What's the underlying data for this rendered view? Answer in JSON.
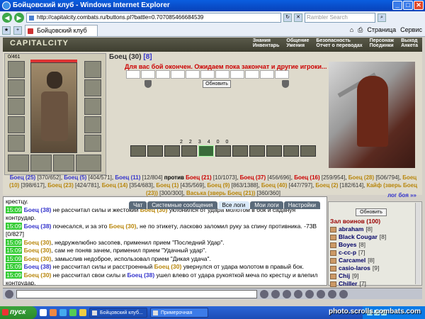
{
  "window": {
    "title": "Бойцовский клуб - Windows Internet Explorer"
  },
  "browser": {
    "url": "http://capitalcity.combats.ru/buttons.pl?battle=0.707085466684539",
    "search_placeholder": "Rambler Search",
    "tab_title": "Бойцовский клуб",
    "page_menu": "Страница",
    "service_menu": "Сервис"
  },
  "game": {
    "logo": "CAPITALCITY",
    "menu": [
      "Знания",
      "Общение",
      "Безопасность",
      "Персонаж",
      "Выход",
      "Инвентарь",
      "Умения",
      "Отчет о переводах",
      "Поединки",
      "Анкета"
    ],
    "player_tag": "0/461",
    "enemy_name": "Боец (30)",
    "enemy_level": "[8]",
    "battle_message": "Для вас бой окончен. Ожидаем пока закончат и другие игроки...",
    "refresh_button": "Обновить",
    "counters": [
      "2",
      "2",
      "3",
      "4",
      "0",
      "0"
    ],
    "vs": "против",
    "logs_link": "лог боя »»"
  },
  "teams": {
    "left": [
      {
        "name": "Боец (25)",
        "hp": "[370/652]"
      },
      {
        "name": "Боец (5)",
        "hp": "[404/571]"
      },
      {
        "name": "Боец (11)",
        "hp": "[12/804]"
      },
      {
        "name": "Боец (28)",
        "hp": "[506/794]"
      },
      {
        "name": "Боец (10)",
        "hp": "[398/617]"
      },
      {
        "name": "Боец (23)",
        "hp": "[424/781]"
      },
      {
        "name": "Боец (14)",
        "hp": "[354/683]"
      },
      {
        "name": "Боец (1)",
        "hp": "[435/569]"
      },
      {
        "name": "Боец (9)",
        "hp": "[863/1388]"
      },
      {
        "name": "Боец (40)",
        "hp": "[447/797]"
      },
      {
        "name": "Боец (2)",
        "hp": "[182/614]"
      }
    ],
    "right": [
      {
        "name": "Боец (21)",
        "hp": "[10/1073]"
      },
      {
        "name": "Боец (37)",
        "hp": "[456/696]"
      },
      {
        "name": "Боец (16)",
        "hp": "[259/954]"
      }
    ],
    "pets": [
      {
        "name": "Кайф (зверь Боец (23))",
        "hp": "[300/300]"
      },
      {
        "name": "Васька (зверь Боец (21))",
        "hp": "[360/360]"
      }
    ]
  },
  "chat": {
    "tabs": [
      "Чат",
      "Системные сообщения",
      "Все логи",
      "Мои логи",
      "Настройки"
    ],
    "lines": [
      {
        "time": "",
        "a": "",
        "text": "крестцу.",
        "b": "",
        "rest": ""
      },
      {
        "time": "15:09",
        "a": "Боец (38)",
        "text": " не рассчитал силы и жестокий ",
        "b": "Боец (30)",
        "rest": " уклонился от удара молотом в бок и садануя контрудар."
      },
      {
        "time": "15:09",
        "a": "Боец (38)",
        "text": " почесался, и за это ",
        "b": "Боец (30)",
        "rest": ", не по этикету, ласково заломил руку за спину противника. -73В [0/827]"
      },
      {
        "time": "15:09",
        "a": "Боец (30)",
        "text": ", недружелюбно засопев, применил прием \"Последний Удар\".",
        "b": "",
        "rest": ""
      },
      {
        "time": "15:09",
        "a": "Боец (30)",
        "text": ", сам не поняв зачем, применил прием \"Удачный удар\".",
        "b": "",
        "rest": ""
      },
      {
        "time": "15:09",
        "a": "Боец (30)",
        "text": ", замыслив недоброе, использовал прием \"Дикая удача\".",
        "b": "",
        "rest": ""
      },
      {
        "time": "15:09",
        "a": "Боец (38)",
        "text": " не рассчитал силы и расстроенный ",
        "b": "Боец (30)",
        "rest": " увернулся от удара молотом в правый бок."
      },
      {
        "time": "15:09",
        "a": "Боец (30)",
        "text": " не рассчитал свои силы и ",
        "b": "Боец (38)",
        "rest": " ушел влево от удара рукояткой меча по крестцу и влепил контрудар."
      }
    ]
  },
  "sidebar": {
    "refresh_button": "Обновить",
    "header": "Зал воинов (100)",
    "users": [
      {
        "name": "abraham",
        "level": "[8]"
      },
      {
        "name": "Black Cougar",
        "level": "[8]"
      },
      {
        "name": "Boyes",
        "level": "[8]"
      },
      {
        "name": "c-cc-p",
        "level": "[7]"
      },
      {
        "name": "Carcamel",
        "level": "[8]"
      },
      {
        "name": "casio-laros",
        "level": "[9]"
      },
      {
        "name": "Chij",
        "level": "[9]"
      },
      {
        "name": "Chiller",
        "level": "[7]"
      }
    ]
  },
  "taskbar": {
    "start": "пуск",
    "tasks": [
      "Бойцовский клуб...",
      "Примерочная"
    ],
    "watermark": "photo.scrolls.combats.com"
  }
}
